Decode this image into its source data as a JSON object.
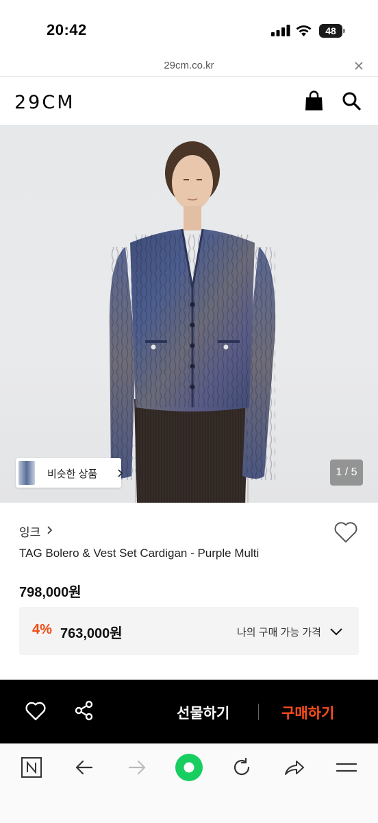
{
  "status_bar": {
    "time": "20:42",
    "battery": "48"
  },
  "url_bar": {
    "domain": "29cm.co.kr"
  },
  "header": {
    "logo": "29CM"
  },
  "gallery": {
    "similar_products_label": "비슷한 상품",
    "page_indicator": "1 / 5"
  },
  "product": {
    "brand": "잉크",
    "name": "TAG Bolero & Vest Set Cardigan - Purple Multi",
    "price": "798,000원",
    "discount_rate": "4%",
    "discount_price": "763,000원",
    "my_price_label": "나의 구매 가능 가격"
  },
  "action_bar": {
    "gift_label": "선물하기",
    "buy_label": "구매하기"
  },
  "colors": {
    "accent": "#ee4b14",
    "buy": "#ff4d1c",
    "action_bar_bg": "#000000",
    "browser_green": "#19ce60"
  },
  "icons": [
    "signal-icon",
    "wifi-icon",
    "battery-icon",
    "close-icon",
    "shopping-bag-icon",
    "search-icon",
    "chevron-right-icon",
    "heart-icon",
    "chevron-down-icon",
    "share-icon",
    "naver-n-icon",
    "back-arrow-icon",
    "forward-arrow-icon",
    "green-home-icon",
    "reload-icon",
    "share-arrow-icon",
    "menu-icon"
  ]
}
